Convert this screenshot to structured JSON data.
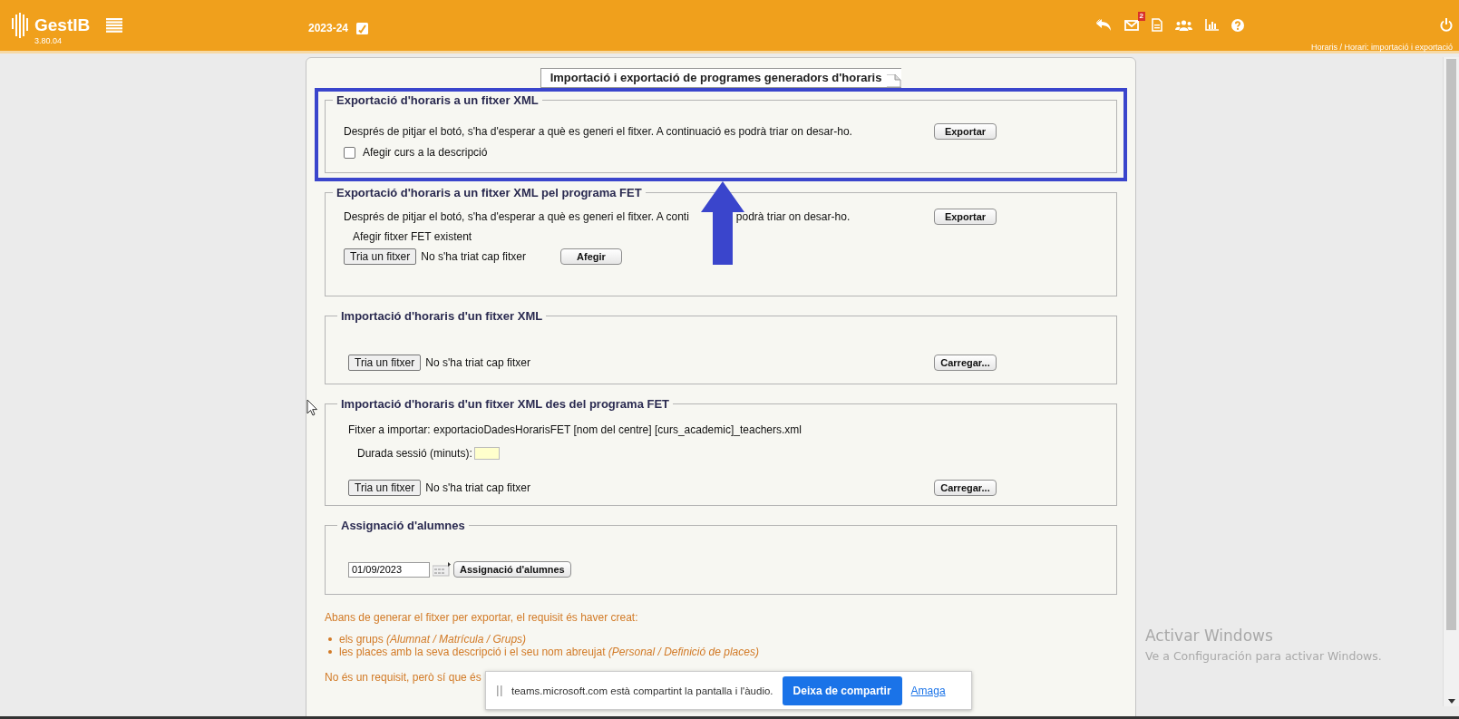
{
  "header": {
    "app_name": "GestIB",
    "version": "3.80.04",
    "school_year": "2023-24",
    "mail_badge": "2",
    "breadcrumb": "Horaris / Horari: importació i exportació"
  },
  "page_title": "Importació i exportació de programes generadors d'horaris",
  "sections": [
    {
      "title": "Exportació d'horaris a un fitxer XML",
      "highlighted": true,
      "rows": [
        [
          {
            "kind": "text",
            "text": "Després de pitjar el botó, s'ha d'esperar a què es generi el fitxer. A continuació es podrà triar on desar-ho."
          },
          {
            "kind": "action",
            "label": "Exportar"
          }
        ],
        [
          {
            "kind": "checkbox",
            "label": "Afegir curs a la descripció",
            "checked": false
          }
        ]
      ]
    },
    {
      "title": "Exportació d'horaris a un fitxer XML pel programa FET",
      "highlighted": false,
      "rows": [
        [
          {
            "kind": "text",
            "text": "Després de pitjar el botó, s'ha d'esperar a què es generi el fitxer. A conti"
          },
          {
            "kind": "text_tail",
            "text": "podrà triar on desar-ho."
          },
          {
            "kind": "action",
            "label": "Exportar"
          }
        ],
        [
          {
            "kind": "label",
            "text": "Afegir fitxer FET existent"
          }
        ],
        [
          {
            "kind": "file",
            "button": "Tria un fitxer",
            "status": "No s'ha triat cap fitxer"
          },
          {
            "kind": "button",
            "label": "Afegir"
          }
        ]
      ]
    },
    {
      "title": "Importació d'horaris d'un fitxer XML",
      "highlighted": false,
      "rows": [
        [
          {
            "kind": "file",
            "button": "Tria un fitxer",
            "status": "No s'ha triat cap fitxer"
          },
          {
            "kind": "action",
            "label": "Carregar..."
          }
        ]
      ]
    },
    {
      "title": "Importació d'horaris d'un fitxer XML des del programa FET",
      "highlighted": false,
      "rows": [
        [
          {
            "kind": "text",
            "text": "Fitxer a importar: exportacioDadesHorarisFET [nom del centre] [curs_academic]_teachers.xml"
          }
        ],
        [
          {
            "kind": "field",
            "label": "Durada sessió (minuts):"
          }
        ],
        [
          {
            "kind": "file",
            "button": "Tria un fitxer",
            "status": "No s'ha triat cap fitxer"
          },
          {
            "kind": "action",
            "label": "Carregar..."
          }
        ]
      ]
    },
    {
      "title": "Assignació d'alumnes",
      "highlighted": false,
      "rows": [
        [
          {
            "kind": "date",
            "value": "01/09/2023"
          },
          {
            "kind": "button",
            "label": "Assignació d'alumnes"
          }
        ]
      ]
    }
  ],
  "notes": {
    "intro": "Abans de generar el fitxer per exportar, el requisit és haver creat:",
    "bullets": [
      "els grups *(Alumnat / Matrícula / Grups)*",
      "les places amb la seva descripció i el seu nom abreujat *(Personal / Definició de places)*"
    ],
    "footer": "No és un requisit, però sí que és"
  },
  "share_bar": {
    "message": "teams.microsoft.com està compartint la pantalla i l'àudio.",
    "stop_button": "Deixa de compartir",
    "hide_link": "Amaga"
  },
  "activation_notice": {
    "title": "Activar Windows",
    "subtitle": "Ve a Configuración para activar Windows."
  }
}
